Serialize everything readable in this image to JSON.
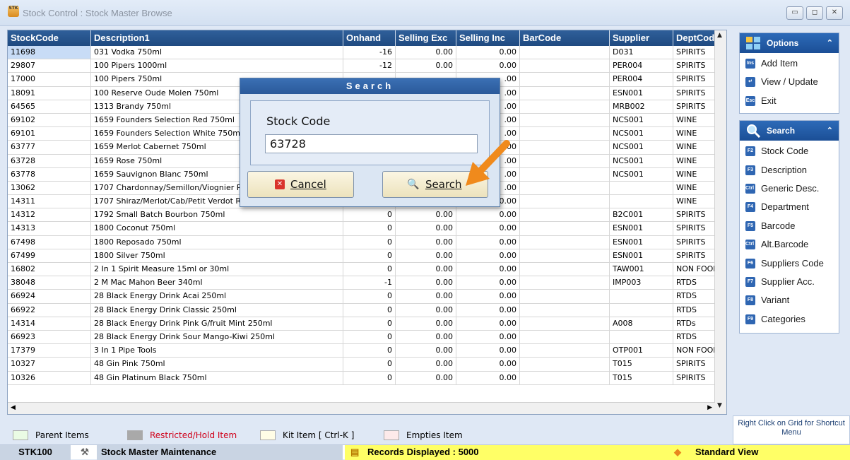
{
  "window": {
    "title": "Stock Control : Stock Master Browse",
    "icon_text": "STK"
  },
  "grid": {
    "columns": [
      "StockCode",
      "Description1",
      "Onhand",
      "Selling Exc",
      "Selling Inc",
      "BarCode",
      "Supplier",
      "DeptCode"
    ],
    "rows": [
      [
        "11698",
        "031 Vodka 750ml",
        "-16",
        "0.00",
        "0.00",
        "",
        "D031",
        "SPIRITS"
      ],
      [
        "29807",
        "100 Pipers 1000ml",
        "-12",
        "0.00",
        "0.00",
        "",
        "PER004",
        "SPIRITS"
      ],
      [
        "17000",
        "100 Pipers 750ml",
        "",
        "",
        ".00",
        "",
        "PER004",
        "SPIRITS"
      ],
      [
        "18091",
        "100 Reserve Oude Molen 750ml",
        "",
        "",
        ".00",
        "",
        "ESN001",
        "SPIRITS"
      ],
      [
        "64565",
        "1313 Brandy 750ml",
        "",
        "",
        ".00",
        "",
        "MRB002",
        "SPIRITS"
      ],
      [
        "69102",
        "1659 Founders Selection Red 750ml",
        "",
        "",
        ".00",
        "",
        "NCS001",
        "WINE"
      ],
      [
        "69101",
        "1659 Founders Selection White 750m",
        "",
        "",
        ".00",
        "",
        "NCS001",
        "WINE"
      ],
      [
        "63777",
        "1659 Merlot Cabernet 750ml",
        "",
        "",
        ".00",
        "",
        "NCS001",
        "WINE"
      ],
      [
        "63728",
        "1659 Rose 750ml",
        "",
        "",
        ".00",
        "",
        "NCS001",
        "WINE"
      ],
      [
        "63778",
        "1659 Sauvignon Blanc 750ml",
        "",
        "",
        ".00",
        "",
        "NCS001",
        "WINE"
      ],
      [
        "13062",
        "1707 Chardonnay/Semillon/Viognier R",
        "",
        "",
        ".00",
        "",
        "",
        "WINE"
      ],
      [
        "14311",
        "1707 Shiraz/Merlot/Cab/Petit Verdot Res 750ml",
        "0",
        "0.00",
        "0.00",
        "",
        "",
        "WINE"
      ],
      [
        "14312",
        "1792 Small Batch Bourbon 750ml",
        "0",
        "0.00",
        "0.00",
        "",
        "B2C001",
        "SPIRITS"
      ],
      [
        "14313",
        "1800 Coconut 750ml",
        "0",
        "0.00",
        "0.00",
        "",
        "ESN001",
        "SPIRITS"
      ],
      [
        "67498",
        "1800 Reposado 750ml",
        "0",
        "0.00",
        "0.00",
        "",
        "ESN001",
        "SPIRITS"
      ],
      [
        "67499",
        "1800 Silver 750ml",
        "0",
        "0.00",
        "0.00",
        "",
        "ESN001",
        "SPIRITS"
      ],
      [
        "16802",
        "2 In 1 Spirit Measure 15ml or 30ml",
        "0",
        "0.00",
        "0.00",
        "",
        "TAW001",
        "NON FOOD"
      ],
      [
        "38048",
        "2 M Mac Mahon Beer 340ml",
        "-1",
        "0.00",
        "0.00",
        "",
        "IMP003",
        "RTDS"
      ],
      [
        "66924",
        "28 Black Energy Drink Acai 250ml",
        "0",
        "0.00",
        "0.00",
        "",
        "",
        "RTDS"
      ],
      [
        "66922",
        "28 Black Energy Drink Classic 250ml",
        "0",
        "0.00",
        "0.00",
        "",
        "",
        "RTDS"
      ],
      [
        "14314",
        "28 Black Energy Drink Pink G/fruit Mint 250ml",
        "0",
        "0.00",
        "0.00",
        "",
        "A008",
        "RTDs"
      ],
      [
        "66923",
        "28 Black Energy Drink Sour Mango-Kiwi 250ml",
        "0",
        "0.00",
        "0.00",
        "",
        "",
        "RTDS"
      ],
      [
        "17379",
        "3 In 1 Pipe Tools",
        "0",
        "0.00",
        "0.00",
        "",
        "OTP001",
        "NON FOOD"
      ],
      [
        "10327",
        "48 Gin Pink 750ml",
        "0",
        "0.00",
        "0.00",
        "",
        "T015",
        "SPIRITS"
      ],
      [
        "10326",
        "48 Gin Platinum Black 750ml",
        "0",
        "0.00",
        "0.00",
        "",
        "T015",
        "SPIRITS"
      ]
    ]
  },
  "legend": {
    "parent": "Parent Items",
    "restricted": "Restricted/Hold Item",
    "kit": "Kit Item [ Ctrl-K ]",
    "empties": "Empties Item"
  },
  "statusbar": {
    "code": "STK100",
    "module": "Stock Master Maintenance",
    "records": "Records Displayed : 5000",
    "view": "Standard View"
  },
  "options_panel": {
    "title": "Options",
    "items": [
      {
        "key": "Ins",
        "label": "Add Item"
      },
      {
        "key": "↵",
        "label": "View / Update"
      },
      {
        "key": "Esc",
        "label": "Exit"
      }
    ]
  },
  "search_panel": {
    "title": "Search",
    "items": [
      {
        "key": "F2",
        "label": "Stock Code"
      },
      {
        "key": "F3",
        "label": "Description"
      },
      {
        "key": "Ctrl F3",
        "label": "Generic Desc."
      },
      {
        "key": "F4",
        "label": "Department"
      },
      {
        "key": "F5",
        "label": "Barcode"
      },
      {
        "key": "Ctrl F5",
        "label": "Alt.Barcode"
      },
      {
        "key": "F6",
        "label": "Suppliers Code"
      },
      {
        "key": "F7",
        "label": "Supplier Acc."
      },
      {
        "key": "F8",
        "label": "Variant"
      },
      {
        "key": "F9",
        "label": "Categories"
      }
    ]
  },
  "hint": "Right Click on Grid for Shortcut Menu",
  "dialog": {
    "title": "Search",
    "field_label": "Stock Code",
    "field_value": "63728",
    "cancel_label": "Cancel",
    "search_label": "Search"
  },
  "colors": {
    "header_blue": "#2a5a9a",
    "status_yellow": "#ffff66",
    "arrow_orange": "#f08a1c"
  }
}
